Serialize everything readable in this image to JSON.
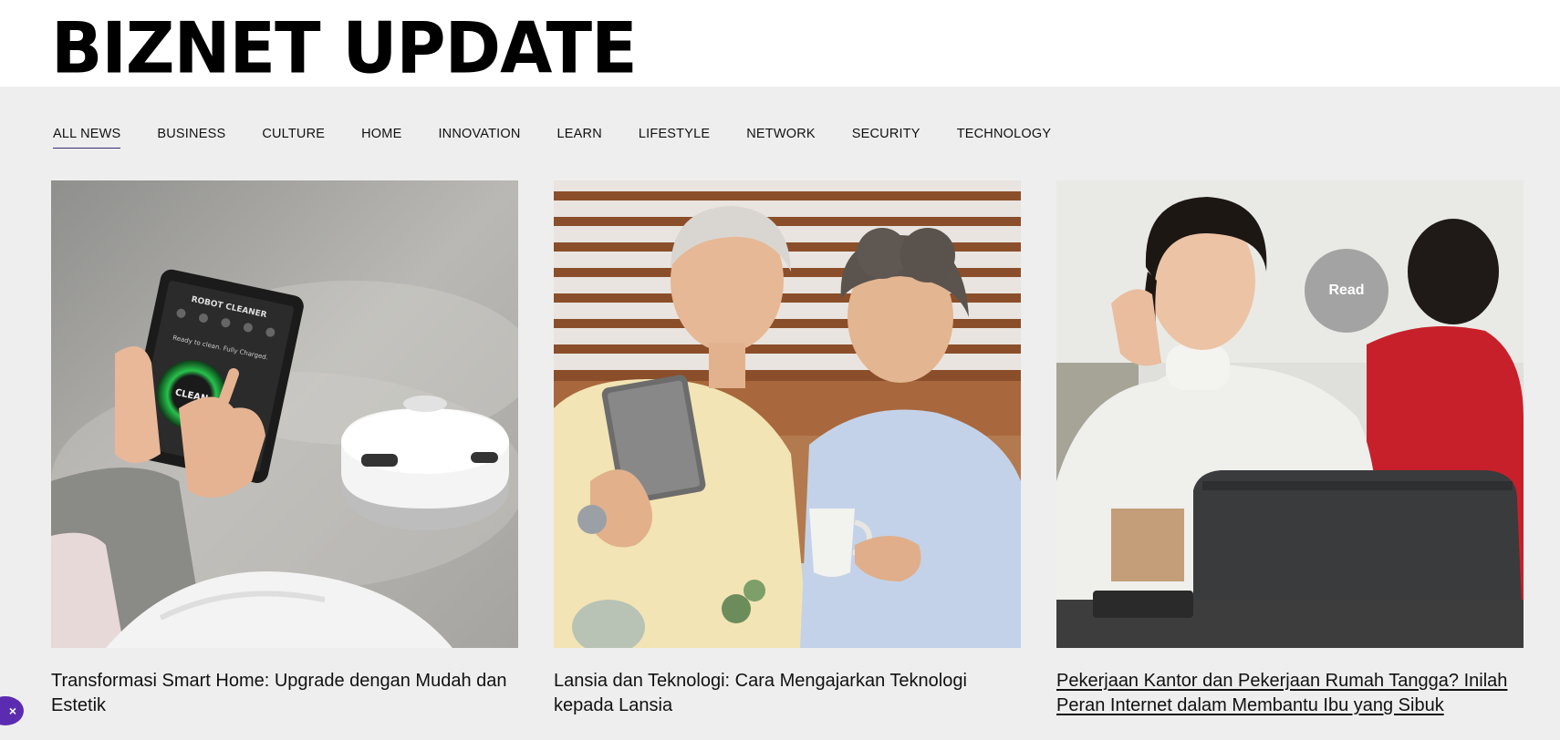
{
  "site": {
    "title": "BIZNET UPDATE"
  },
  "nav": {
    "items": [
      {
        "label": "ALL NEWS",
        "active": true
      },
      {
        "label": "BUSINESS"
      },
      {
        "label": "CULTURE"
      },
      {
        "label": "HOME"
      },
      {
        "label": "INNOVATION"
      },
      {
        "label": "LEARN"
      },
      {
        "label": "LIFESTYLE"
      },
      {
        "label": "NETWORK"
      },
      {
        "label": "SECURITY"
      },
      {
        "label": "TECHNOLOGY"
      }
    ]
  },
  "articles": [
    {
      "title": "Transformasi Smart Home: Upgrade dengan Mudah dan Estetik",
      "image_labels": {
        "header": "ROBOT CLEANER",
        "status": "Ready to clean. Fully Charged.",
        "button": "CLEAN"
      }
    },
    {
      "title": "Lansia dan Teknologi: Cara Mengajarkan Teknologi kepada Lansia"
    },
    {
      "title": "Pekerjaan Kantor dan Pekerjaan Rumah Tangga? Inilah Peran Internet dalam Membantu Ibu yang Sibuk",
      "hover_badge": "Read"
    }
  ],
  "fab": {
    "icon": "close-icon",
    "glyph": "×"
  }
}
